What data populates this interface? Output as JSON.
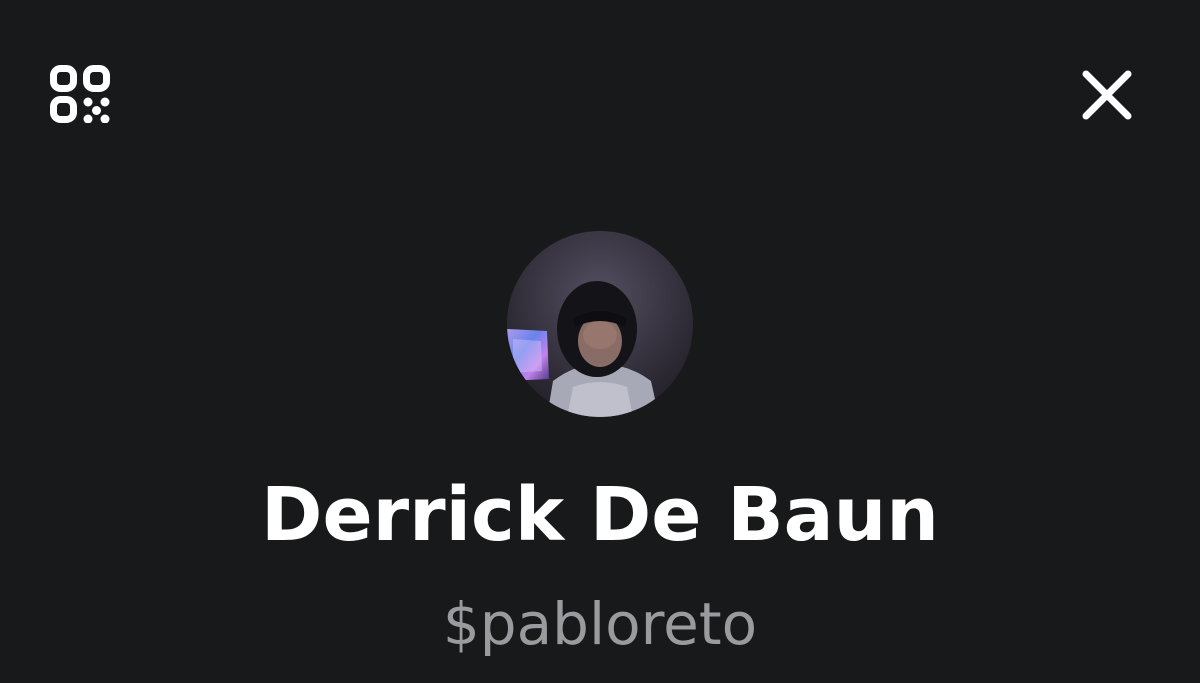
{
  "header": {
    "left_icon": "qr-code-icon",
    "right_icon": "close-icon"
  },
  "profile": {
    "avatar_icon": "profile-photo",
    "name": "Derrick De Baun",
    "cashtag": "$pabloreto"
  },
  "colors": {
    "background": "#18191b",
    "name_text": "#ffffff",
    "cashtag_text": "#9b9b9f",
    "icon": "#ffffff"
  }
}
